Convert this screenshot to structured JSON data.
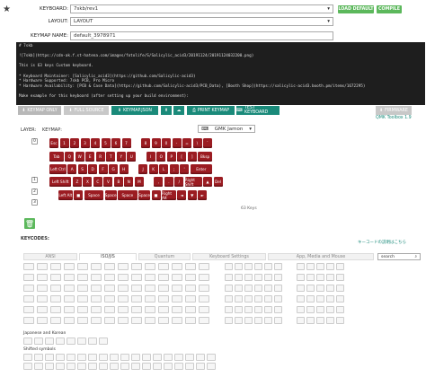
{
  "form": {
    "keyboard_label": "KEYBOARD:",
    "keyboard_value": "7skb/rev1",
    "layout_label": "LAYOUT:",
    "layout_value": "LAYOUT",
    "keymap_label": "KEYMAP NAME:",
    "keymap_value": "default_3978971",
    "load_default": "LOAD DEFAULT",
    "compile": "COMPILE"
  },
  "readme": "# 7skb\n\n![7skb](https://cdn-ak.f.st-hatena.com/images/fotolife/S/Salicylic_acid3/20191124/20191124032200.png)\n\nThis is 63 keys Custom keyboard.\n\n* Keyboard Maintainer: [Salicylic_acid3](https://github.com/Salicylic-acid3)\n* Hardware Supported: 7skb PCB, Pro Micro\n* Hardware Availability: [PCB & Case Data](https://github.com/Salicylic-acid3/PCB_Data), [Booth Shop](https://salicylic-acid3.booth.pm/items/1672295)\n\nMake example for this keyboard (after setting up your build environment):",
  "toolbar": {
    "keymap_only": "KEYMAP ONLY",
    "full_source": "FULL SOURCE",
    "keymap_json": "KEYMAP.JSON",
    "print_keymap": "PRINT KEYMAP",
    "test_keyboard": "TEST KEYBOARD",
    "firmware": "FIRMWARE",
    "toolbox": "QMK Toolbox 1.9"
  },
  "layer_label": "LAYER:",
  "keymap_label": "KEYMAP:",
  "keyset": "GMK Jamon",
  "key_count": "63 Keys",
  "layers": [
    "0",
    "1",
    "2",
    "3"
  ],
  "keys": [
    [
      "Esc",
      "1",
      "2",
      "3",
      "4",
      "5",
      "6",
      "7",
      "8",
      "9",
      "0",
      "-",
      "=",
      "\\",
      "`"
    ],
    [
      "Tab",
      "Q",
      "W",
      "E",
      "R",
      "T",
      "Y",
      "U",
      "I",
      "O",
      "P",
      "[",
      "]",
      "Bksp"
    ],
    [
      "Left Ctrl",
      "A",
      "S",
      "D",
      "F",
      "G",
      "H",
      "J",
      "K",
      "L",
      ";",
      "'",
      "Enter"
    ],
    [
      "Left Shift",
      "Z",
      "X",
      "C",
      "V",
      "B",
      "N",
      "M",
      ",",
      ".",
      "/",
      "Right Shift",
      "▲",
      "Del"
    ],
    [
      "Left Alt",
      "■",
      "Space",
      "Space",
      "Space",
      "Space",
      "■",
      "Right Alt",
      "◄",
      "▼",
      "►"
    ]
  ],
  "keycodes_label": "KEYCODES:",
  "jp_link": "キーコードの説明はこちら",
  "tabs": [
    "ANSI",
    "ISO/JIS",
    "Quantum",
    "Keyboard Settings",
    "App, Media and Mouse"
  ],
  "search": "search",
  "jp_section": "Japanese and Korean",
  "shifted_section": "Shifted symbols",
  "colors": {
    "accent": "#9b1c22",
    "green": "#5cb85c",
    "teal": "#1a8a7a"
  }
}
